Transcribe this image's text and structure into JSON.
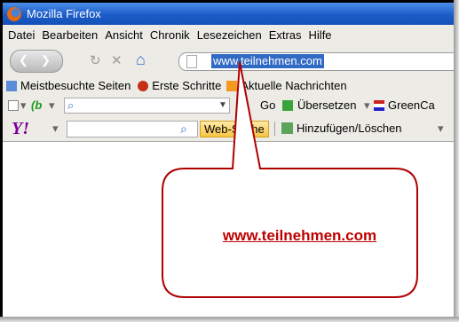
{
  "window": {
    "title": "Mozilla Firefox"
  },
  "menu": {
    "items": [
      "Datei",
      "Bearbeiten",
      "Ansicht",
      "Chronik",
      "Lesezeichen",
      "Extras",
      "Hilfe"
    ]
  },
  "nav": {
    "url": "www.teilnehmen.com"
  },
  "bookmarks": {
    "items": [
      "Meistbesuchte Seiten",
      "Erste Schritte",
      "Aktuelle Nachrichten"
    ]
  },
  "toolbar2": {
    "go_label": "Go",
    "translate_label": "Übersetzen",
    "greencard_label": "GreenCa"
  },
  "yahoo_toolbar": {
    "logo": "Y!",
    "search_button": "Web-Suche",
    "add_remove_label": "Hinzufügen/Löschen"
  },
  "callout": {
    "text": "www.teilnehmen.com",
    "border_color": "#b00000",
    "fill_color": "#ffffff"
  }
}
